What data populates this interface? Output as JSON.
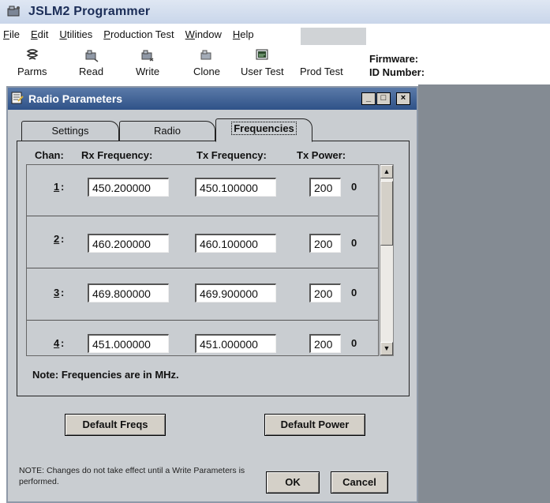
{
  "app": {
    "title": "JSLM2 Programmer",
    "menu": [
      {
        "pre": "",
        "key": "F",
        "post": "ile"
      },
      {
        "pre": "",
        "key": "E",
        "post": "dit"
      },
      {
        "pre": "",
        "key": "U",
        "post": "tilities"
      },
      {
        "pre": "",
        "key": "P",
        "post": "roduction Test"
      },
      {
        "pre": "",
        "key": "W",
        "post": "indow"
      },
      {
        "pre": "",
        "key": "H",
        "post": "elp"
      }
    ],
    "toolbar": {
      "parms": "Parms",
      "read": "Read",
      "write": "Write",
      "clone": "Clone",
      "user_test": "User Test",
      "prod_test": "Prod Test"
    },
    "firmware_label": "Firmware:",
    "id_label": "ID Number:",
    "colors": {
      "titlebar": "#c9d6ea",
      "dialog_titlebar": "#2f5288",
      "workspace": "#848b93",
      "dialog_bg": "#c9cdd1"
    }
  },
  "dialog": {
    "title": "Radio Parameters",
    "tabs": {
      "settings": "Settings",
      "radio": "Radio",
      "frequencies": "Frequencies"
    },
    "active_tab": "Frequencies",
    "columns": {
      "chan": "Chan:",
      "rx": "Rx Frequency:",
      "tx": "Tx Frequency:",
      "power": "Tx Power:"
    },
    "rows": [
      {
        "num": "1",
        "rx": "450.200000",
        "tx": "450.100000",
        "power": "200",
        "extra": "0"
      },
      {
        "num": "2",
        "rx": "460.200000",
        "tx": "460.100000",
        "power": "200",
        "extra": "0"
      },
      {
        "num": "3",
        "rx": "469.800000",
        "tx": "469.900000",
        "power": "200",
        "extra": "0"
      },
      {
        "num": "4",
        "rx": "451.000000",
        "tx": "451.000000",
        "power": "200",
        "extra": "0"
      }
    ],
    "note_mhz": "Note: Frequencies are in MHz.",
    "buttons": {
      "default_freqs": "Default Freqs",
      "default_power": "Default Power",
      "ok": "OK",
      "cancel": "Cancel"
    },
    "write_note": "NOTE:  Changes do not take effect until a Write Parameters is performed."
  }
}
